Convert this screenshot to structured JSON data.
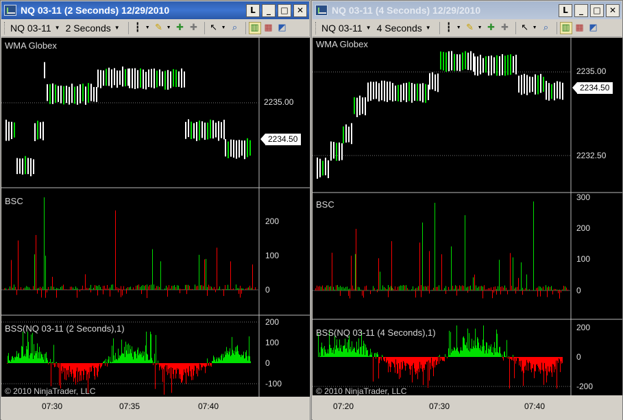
{
  "left": {
    "title": "NQ 03-11 (2 Seconds)  12/29/2010",
    "title_state": "active",
    "window_buttons": {
      "link": "L",
      "minimize": "_",
      "maximize": "□",
      "close": "✕"
    },
    "toolbar": {
      "instrument": "NQ 03-11",
      "interval": "2 Seconds",
      "icons": [
        "bar-type-icon",
        "draw-pencil-icon",
        "add-indicator-icon",
        "strategy-icon",
        "cursor-icon",
        "zoom-icon",
        "chart-style-candle-icon",
        "chart-style-bar-icon",
        "properties-icon"
      ]
    },
    "panels": {
      "price_label": "WMA Globex",
      "bsc_label": "BSC",
      "bss_label": "BSS(NQ 03-11 (2 Seconds),1)"
    },
    "price_axis": [
      "2235.00"
    ],
    "last_price": "2234.50",
    "bsc_axis": [
      "200",
      "100",
      "0"
    ],
    "bss_axis": [
      "200",
      "100",
      "0",
      "-100"
    ],
    "copyright": "© 2010 NinjaTrader, LLC",
    "x_axis": [
      "07:30",
      "07:35",
      "07:40"
    ]
  },
  "right": {
    "title": "NQ 03-11 (4 Seconds)  12/29/2010",
    "title_state": "inactive",
    "window_buttons": {
      "link": "L",
      "minimize": "_",
      "maximize": "□",
      "close": "✕"
    },
    "toolbar": {
      "instrument": "NQ 03-11",
      "interval": "4 Seconds",
      "icons": [
        "bar-type-icon",
        "draw-pencil-icon",
        "add-indicator-icon",
        "strategy-icon",
        "cursor-icon",
        "zoom-icon",
        "chart-style-candle-icon",
        "chart-style-bar-icon",
        "properties-icon"
      ]
    },
    "panels": {
      "price_label": "WMA Globex",
      "bsc_label": "BSC",
      "bss_label": "BSS(NQ 03-11 (4 Seconds),1)"
    },
    "price_axis": [
      "2235.00",
      "2232.50"
    ],
    "last_price": "2234.50",
    "bsc_axis": [
      "300",
      "200",
      "100",
      "0"
    ],
    "bss_axis": [
      "200",
      "0",
      "-200"
    ],
    "copyright": "© 2010 NinjaTrader, LLC",
    "x_axis": [
      "07:20",
      "07:30",
      "07:40"
    ]
  },
  "colors": {
    "background": "#000000",
    "up": "#00e000",
    "down": "#ff0000",
    "bar_outline": "#ffffff",
    "active_title": "#3d74d0",
    "inactive_title": "#bac7da"
  }
}
